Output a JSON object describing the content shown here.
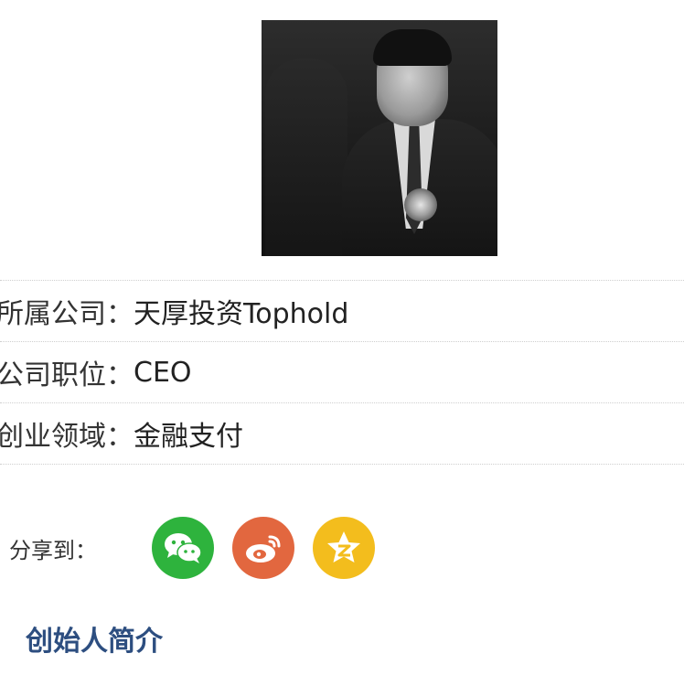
{
  "profile": {
    "company_label": "所属公司：",
    "company_value": "天厚投资Tophold",
    "position_label": "公司职位：",
    "position_value": "CEO",
    "field_label": "创业领域：",
    "field_value": "金融支付"
  },
  "share": {
    "label": "分享到：",
    "icons": [
      "wechat-icon",
      "weibo-icon",
      "qzone-icon"
    ],
    "colors": {
      "wechat": "#2eb33d",
      "weibo": "#e2673f",
      "qzone": "#f3bd1d"
    }
  },
  "section": {
    "title": "创始人简介",
    "color": "#2d4e80"
  }
}
